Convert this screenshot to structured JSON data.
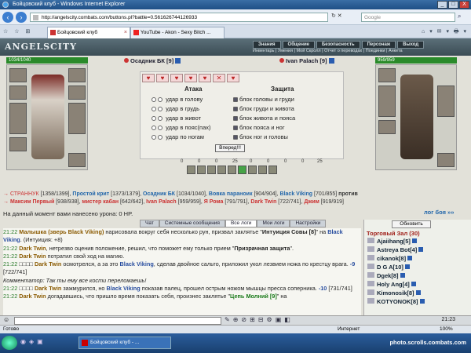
{
  "window": {
    "title": "Бойцовский клуб - Windows Internet Explorer",
    "min": "_",
    "max": "□",
    "close": "X"
  },
  "addressbar": {
    "back": "‹",
    "forward": "›",
    "url": "http://angelscity.combats.com/buttons.pl?battle=0.561626744126933",
    "tools": "↻ ✕",
    "search_placeholder": "Google",
    "search_go": "⌕"
  },
  "tabs": [
    {
      "label": "Бойцовский клуб",
      "active": true
    },
    {
      "label": "YouTube - Akon - Sexy Bitch ...",
      "active": false
    }
  ],
  "tabtools": "☆ ☆ ⊞",
  "pagetools": "⌂ ▾ ✉ ▾ 🖶 ▾",
  "game": {
    "logo": "ANGELSCITY",
    "menu_top": [
      "Знания",
      "Общение",
      "Безопасность",
      "Персонаж",
      "Выход"
    ],
    "menu_bottom": "Инвентарь | Умения | Мой Скролл | Отчет о переводах | Поединки | Анкета",
    "left": {
      "hp": "1034/1040",
      "name": "Осадник БК [9]"
    },
    "right": {
      "hp": "959/959",
      "name": "Ivan Palach [9]"
    },
    "attack_title": "Атака",
    "defense_title": "Защита",
    "attacks": [
      "удар в голову",
      "удар в грудь",
      "удар в живот",
      "удар в пояс(пах)",
      "удар по ногам"
    ],
    "defenses": [
      "блок головы и груди",
      "блок груди и живота",
      "блок живота и пояса",
      "блок пояса и ног",
      "блок ног и головы"
    ],
    "forward": "Вперед!!!",
    "stats": [
      "0",
      "0",
      "0",
      "25",
      "0",
      "0",
      "0",
      "0",
      "25"
    ],
    "party_left": [
      {
        "n": "СТРАННУК",
        "s": "[1358/1399],"
      },
      {
        "n": "Простой крит",
        "s": "[1373/1379],"
      },
      {
        "n": "Осадник БК",
        "s": "[1034/1040],"
      },
      {
        "n": "Вовка параноик",
        "s": "[904/904],"
      },
      {
        "n": "Black Viking",
        "s": "[701/855]"
      }
    ],
    "versus": "против",
    "party_right": [
      {
        "n": "Максим Первый",
        "s": "[938/938],"
      },
      {
        "n": "мистер кабан",
        "s": "[642/642],"
      },
      {
        "n": "Ivan Palach",
        "s": "[959/959],"
      },
      {
        "n": "Я Рома",
        "s": "[791/791],"
      },
      {
        "n": "Dark Twin",
        "s": "[722/741],"
      },
      {
        "n": "Джим",
        "s": "[919/919]"
      }
    ],
    "damage": "На данный момент вами нанесено урона: 0 HP.",
    "log_link": "лог боя »»",
    "chat_tabs": [
      "Чат",
      "Системные сообщения",
      "Все логи",
      "Мои логи",
      "Настройки"
    ],
    "chat": [
      {
        "t": "21:22",
        "parts": [
          [
            "nm",
            "Малышка (зверь Black Viking)"
          ],
          [
            "",
            " нарисовала вокруг себя несколько рун, призвал заклятье \""
          ],
          [
            "b",
            "Интуиция Совы [8]"
          ],
          [
            "",
            "\" на "
          ],
          [
            "bl",
            "Black Viking"
          ],
          [
            "",
            ". (Интуиция: +8)"
          ]
        ]
      },
      {
        "t": "21:22",
        "parts": [
          [
            "nm",
            "Dark Twin"
          ],
          [
            "",
            ", нетрезво оценив положение, решил, что поможет ему только прием \""
          ],
          [
            "b",
            "Призрачная защита"
          ],
          [
            "",
            "\"."
          ]
        ]
      },
      {
        "t": "21:22",
        "parts": [
          [
            "nm",
            "Dark Twin"
          ],
          [
            "",
            " потратил свой ход на магию."
          ]
        ]
      },
      {
        "t": "21:22",
        "parts": [
          [
            "",
            "□□□□ "
          ],
          [
            "nm",
            "Dark Twin"
          ],
          [
            "",
            " осмотрелся, а за это "
          ],
          [
            "bl",
            "Black Viking"
          ],
          [
            "",
            ", сделав двойное сальто, приложил укол лезвием ножа по крестцу врага. "
          ],
          [
            "bl",
            "-9"
          ],
          [
            "",
            " [722/741]"
          ]
        ]
      },
      {
        "t": "",
        "parts": [
          [
            "m",
            "Комментатор: Так ты ему все кости переломаешь!"
          ]
        ]
      },
      {
        "t": "21:22",
        "parts": [
          [
            "",
            "□□□□ "
          ],
          [
            "nm",
            "Dark Twin"
          ],
          [
            "",
            " зажмурился, но "
          ],
          [
            "bl",
            "Black Viking"
          ],
          [
            "",
            " показав палец, прошел острым ножом мышцы пресса соперника. "
          ],
          [
            "bl",
            "-10"
          ],
          [
            "",
            " [731/741]"
          ]
        ]
      },
      {
        "t": "21:22",
        "parts": [
          [
            "nm",
            "Dark Twin"
          ],
          [
            "",
            " догадавшись, что пришло время показать себя, произнес заклятье \""
          ],
          [
            "g",
            "Цепь Молний [9]"
          ],
          [
            "",
            "\" на"
          ]
        ]
      }
    ],
    "refresh": "Обновить",
    "room": "Торговый Зал (30)",
    "users": [
      "Ajaiihang[5]",
      "Astreya Bot[4]",
      "cikanok[8]",
      "D G A[10]",
      "Dgek[8]",
      "Holy Ang[4]",
      "Kimonosik[8]",
      "KOTYONOK[8]"
    ],
    "clock": "21:23"
  },
  "statusbar": {
    "left": "Готово",
    "zone": "Интернет",
    "zoom": "100%"
  },
  "taskbar": {
    "task": "Бойцовский клуб - ...",
    "watermark": "photo.scrolls.combats.com"
  }
}
